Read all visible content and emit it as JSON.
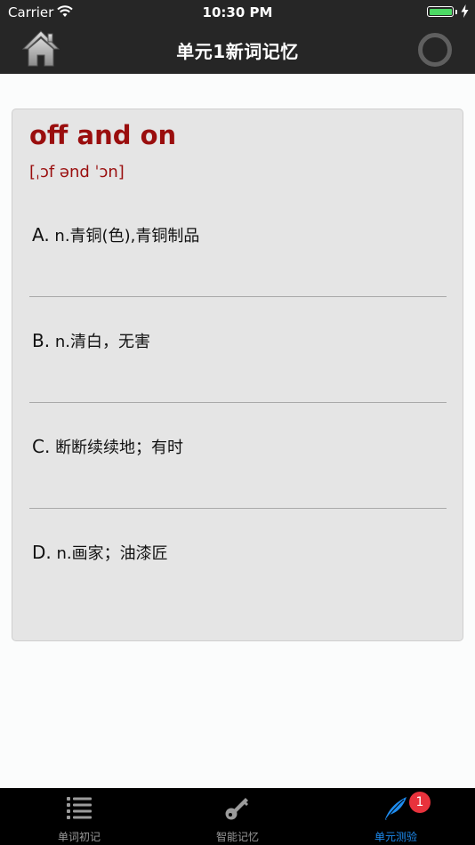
{
  "status_bar": {
    "carrier": "Carrier",
    "time": "10:30 PM",
    "battery_level": 1.0,
    "charging": true
  },
  "nav": {
    "title": "单元1新词记忆",
    "home_icon": "home-icon",
    "progress_icon": "progress-ring-icon"
  },
  "card": {
    "word": "off and on",
    "phonetic": "[ˌɔf ənd ˈɔn]",
    "options": [
      {
        "letter": "A.",
        "text": "n.青铜(色),青铜制品"
      },
      {
        "letter": "B.",
        "text": "n.清白，无害"
      },
      {
        "letter": "C.",
        "text": "断断续续地；有时"
      },
      {
        "letter": "D.",
        "text": "n.画家；油漆匠"
      }
    ]
  },
  "tabs": [
    {
      "label": "单词初记",
      "icon": "list-icon",
      "active": false
    },
    {
      "label": "智能记忆",
      "icon": "key-icon",
      "active": false
    },
    {
      "label": "单元测验",
      "icon": "feather-icon",
      "active": true,
      "badge": "1"
    }
  ],
  "colors": {
    "bar_background": "#262626",
    "word_color": "#9a0e0e",
    "active_tab": "#1e8cf0",
    "badge": "#e8323c"
  }
}
